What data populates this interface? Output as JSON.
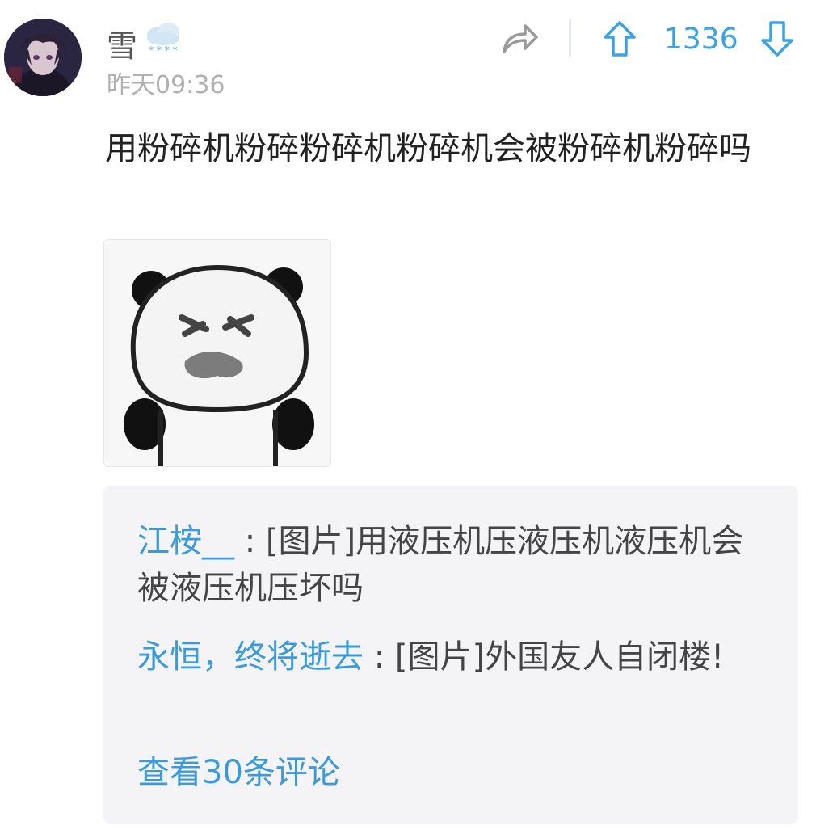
{
  "post": {
    "username": "雪",
    "timestamp": "昨天09:36",
    "vote_count": "1336",
    "text": "用粉碎机粉碎粉碎机粉碎机会被粉碎机粉碎吗"
  },
  "icons": {
    "weather": "snow-cloud-icon",
    "share": "share-icon",
    "upvote": "arrow-up-icon",
    "downvote": "arrow-down-icon"
  },
  "comments": [
    {
      "author": "江桉__",
      "separator": " : ",
      "text": "[图片]用液压机压液压机液压机会被液压机压坏吗"
    },
    {
      "author": "永恒，终将逝去",
      "separator": " : ",
      "text": "[图片]外国友人自闭楼!"
    }
  ],
  "view_all_label": "查看30条评论",
  "colors": {
    "accent": "#3a9bdc",
    "muted": "#b0b0b0",
    "comment_bg": "#f4f4f6"
  }
}
